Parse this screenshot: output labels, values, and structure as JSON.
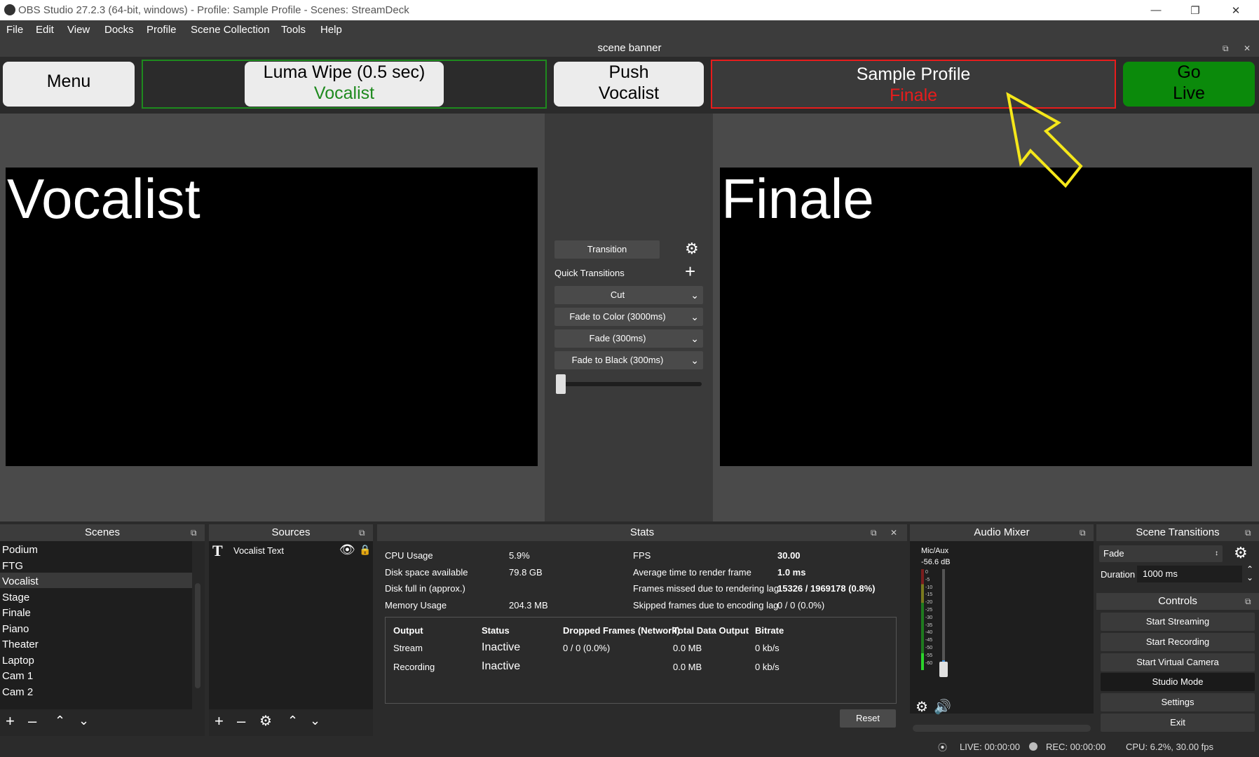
{
  "window": {
    "title": "OBS Studio 27.2.3 (64-bit, windows) - Profile: Sample Profile - Scenes: StreamDeck"
  },
  "menu": [
    "File",
    "Edit",
    "View",
    "Docks",
    "Profile",
    "Scene Collection",
    "Tools",
    "Help"
  ],
  "banner": {
    "title": "scene banner",
    "menu_label": "Menu",
    "transition_label": "Luma Wipe (0.5 sec)",
    "transition_scene": "Vocalist",
    "push_line1": "Push",
    "push_line2": "Vocalist",
    "profile_label": "Sample Profile",
    "profile_scene": "Finale",
    "golive_line1": "Go",
    "golive_line2": "Live"
  },
  "preview": {
    "text": "Vocalist"
  },
  "program": {
    "text": "Finale"
  },
  "transitions_panel": {
    "transition_button": "Transition",
    "quick_transitions_label": "Quick Transitions",
    "items": [
      "Cut",
      "Fade to Color (3000ms)",
      "Fade (300ms)",
      "Fade to Black (300ms)"
    ]
  },
  "scenes": {
    "title": "Scenes",
    "items": [
      "Podium",
      "FTG",
      "Vocalist",
      "Stage",
      "Finale",
      "Piano",
      "Theater",
      "Laptop",
      "Cam 1",
      "Cam 2"
    ],
    "selected": "Vocalist"
  },
  "sources": {
    "title": "Sources",
    "items": [
      "Vocalist Text"
    ]
  },
  "stats": {
    "title": "Stats",
    "left": [
      {
        "label": "CPU Usage",
        "value": "5.9%"
      },
      {
        "label": "Disk space available",
        "value": "79.8 GB"
      },
      {
        "label": "Disk full in (approx.)",
        "value": ""
      },
      {
        "label": "Memory Usage",
        "value": "204.3 MB"
      }
    ],
    "right": [
      {
        "label": "FPS",
        "value": "30.00"
      },
      {
        "label": "Average time to render frame",
        "value": "1.0 ms"
      },
      {
        "label": "Frames missed due to rendering lag",
        "value": "15326 / 1969178 (0.8%)"
      },
      {
        "label": "Skipped frames due to encoding lag",
        "value": "0 / 0 (0.0%)"
      }
    ],
    "table_headers": [
      "Output",
      "Status",
      "Dropped Frames (Network)",
      "Total Data Output",
      "Bitrate"
    ],
    "rows": [
      {
        "output": "Stream",
        "status": "Inactive",
        "dropped": "0 / 0 (0.0%)",
        "total": "0.0 MB",
        "bitrate": "0 kb/s"
      },
      {
        "output": "Recording",
        "status": "Inactive",
        "dropped": "",
        "total": "0.0 MB",
        "bitrate": "0 kb/s"
      }
    ],
    "reset_label": "Reset"
  },
  "audio_mixer": {
    "title": "Audio Mixer",
    "channel": "Mic/Aux",
    "level": "-56.6 dB",
    "scale": [
      "0",
      "-5",
      "-10",
      "-15",
      "-20",
      "-25",
      "-30",
      "-35",
      "-40",
      "-45",
      "-50",
      "-55",
      "-60"
    ]
  },
  "scene_transitions": {
    "title": "Scene Transitions",
    "selected": "Fade",
    "duration_label": "Duration",
    "duration_value": "1000 ms"
  },
  "controls": {
    "title": "Controls",
    "buttons": [
      "Start Streaming",
      "Start Recording",
      "Start Virtual Camera",
      "Studio Mode",
      "Settings",
      "Exit"
    ]
  },
  "status_bar": {
    "live": "LIVE: 00:00:00",
    "rec": "REC: 00:00:00",
    "cpu": "CPU: 6.2%, 30.00 fps"
  },
  "colors": {
    "green": "#1e8a1e",
    "red": "#e81c1c",
    "live_button": "#0b8a0b",
    "arrow": "#f5e71a"
  }
}
